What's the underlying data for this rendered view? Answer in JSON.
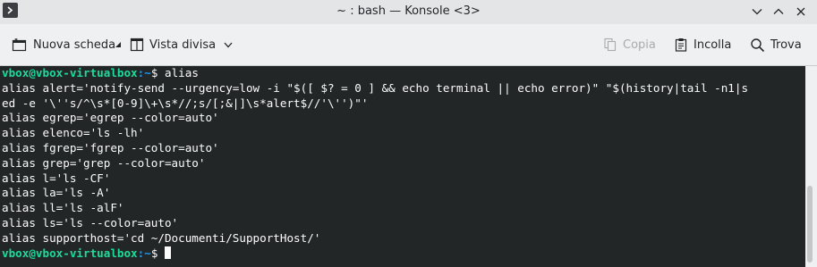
{
  "window": {
    "title": "~ : bash — Konsole <3>"
  },
  "toolbar": {
    "new_tab_label": "Nuova scheda",
    "split_view_label": "Vista divisa",
    "copy_label": "Copia",
    "paste_label": "Incolla",
    "find_label": "Trova"
  },
  "terminal": {
    "prompt_user": "vbox@vbox-virtualbox",
    "prompt_path": ":~",
    "prompt_sign": "$ ",
    "command": "alias",
    "output": [
      "alias alert='notify-send --urgency=low -i \"$([ $? = 0 ] && echo terminal || echo error)\" \"$(history|tail -n1|s",
      "ed -e '\\''s/^\\s*[0-9]\\+\\s*//;s/[;&|]\\s*alert$//'\\'')\"'",
      "alias egrep='egrep --color=auto'",
      "alias elenco='ls -lh'",
      "alias fgrep='fgrep --color=auto'",
      "alias grep='grep --color=auto'",
      "alias l='ls -CF'",
      "alias la='ls -A'",
      "alias ll='ls -alF'",
      "alias ls='ls --color=auto'",
      "alias supporthost='cd ~/Documenti/SupportHost/'"
    ]
  },
  "colors": {
    "terminal_bg": "#232627",
    "terminal_fg": "#fcfcfc",
    "prompt_user": "#1cdc9a",
    "prompt_path": "#1d99f3"
  }
}
